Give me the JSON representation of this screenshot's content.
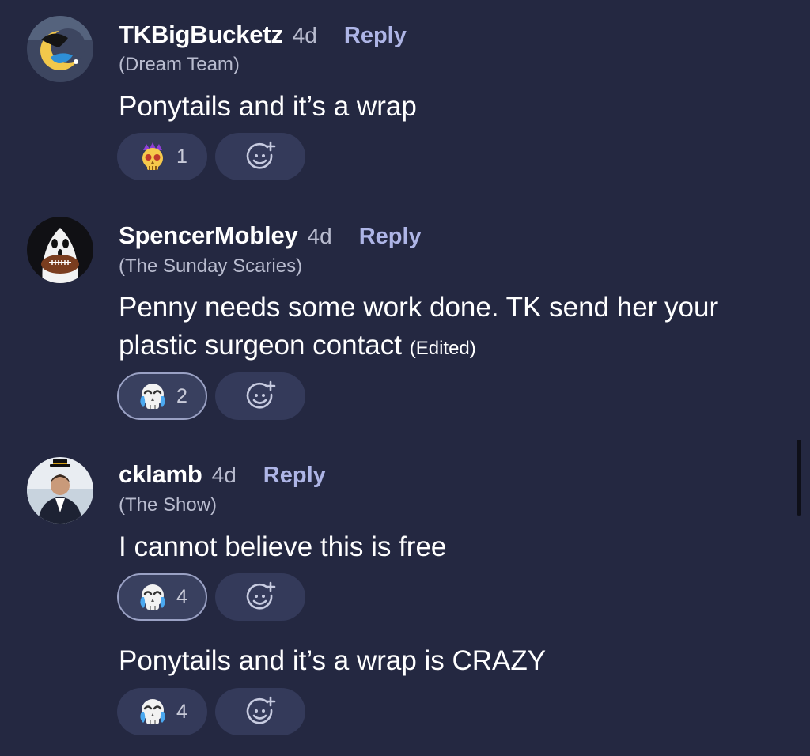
{
  "comments": [
    {
      "username": "TKBigBucketz",
      "age": "4d",
      "reply_label": "Reply",
      "team": "(Dream Team)",
      "messages": [
        {
          "text": "Ponytails and it’s a wrap",
          "reaction": {
            "emoji": "crowned-skull-emoji",
            "count": "1",
            "selected": false
          }
        }
      ]
    },
    {
      "username": "SpencerMobley",
      "age": "4d",
      "reply_label": "Reply",
      "team": "(The Sunday Scaries)",
      "messages": [
        {
          "text": "Penny needs some work done. TK send her your plastic surgeon contact",
          "edited_label": "(Edited)",
          "reaction": {
            "emoji": "crying-skull-emoji",
            "count": "2",
            "selected": true
          }
        }
      ]
    },
    {
      "username": "cklamb",
      "age": "4d",
      "reply_label": "Reply",
      "team": "(The Show)",
      "messages": [
        {
          "text": "I cannot believe this is free",
          "reaction": {
            "emoji": "crying-skull-emoji",
            "count": "4",
            "selected": true
          }
        },
        {
          "text": "Ponytails and it’s a wrap is CRAZY",
          "reaction": {
            "emoji": "crying-skull-emoji",
            "count": "4",
            "selected": false
          }
        }
      ]
    }
  ],
  "colors": {
    "background": "#242841",
    "reply_accent": "#aeb5e6",
    "pill_background": "#343a5a",
    "meta_text": "#b9bccf"
  },
  "icons": {
    "add_reaction": "smiley-plus-icon"
  }
}
